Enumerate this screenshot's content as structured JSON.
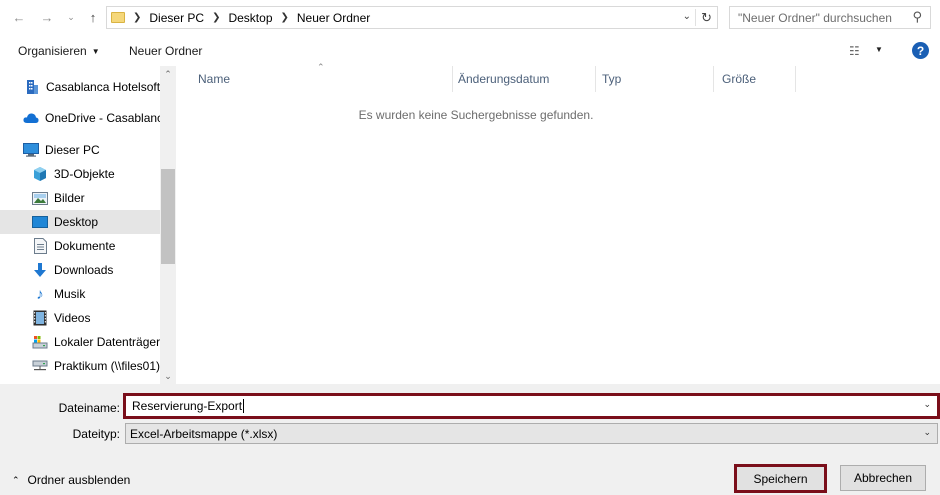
{
  "nav_buttons": {
    "back_icon": "arrow-left-icon",
    "forward_icon": "arrow-right-icon",
    "recent_icon": "chevron-down-icon",
    "up_icon": "arrow-up-icon"
  },
  "address": {
    "crumbs": [
      "Dieser PC",
      "Desktop",
      "Neuer Ordner"
    ]
  },
  "search": {
    "placeholder": "\"Neuer Ordner\" durchsuchen"
  },
  "toolbar": {
    "organize_label": "Organisieren",
    "new_folder_label": "Neuer Ordner"
  },
  "sidebar": {
    "items": [
      {
        "label": "Casablanca Hotelsoftware",
        "icon": "building-icon",
        "selected": false
      },
      {
        "label": "OneDrive - Casablanca",
        "icon": "cloud-icon",
        "selected": false
      },
      {
        "label": "Dieser PC",
        "icon": "computer-icon",
        "selected": false
      },
      {
        "label": "3D-Objekte",
        "icon": "cube-icon",
        "selected": false
      },
      {
        "label": "Bilder",
        "icon": "pictures-icon",
        "selected": false
      },
      {
        "label": "Desktop",
        "icon": "desktop-icon",
        "selected": true
      },
      {
        "label": "Dokumente",
        "icon": "document-icon",
        "selected": false
      },
      {
        "label": "Downloads",
        "icon": "download-icon",
        "selected": false
      },
      {
        "label": "Musik",
        "icon": "music-icon",
        "selected": false
      },
      {
        "label": "Videos",
        "icon": "video-icon",
        "selected": false
      },
      {
        "label": "Lokaler Datenträger",
        "icon": "drive-icon",
        "selected": false
      },
      {
        "label": "Praktikum (\\\\files01)",
        "icon": "network-drive-icon",
        "selected": false
      }
    ]
  },
  "columns": [
    "Name",
    "Änderungsdatum",
    "Typ",
    "Größe"
  ],
  "empty_message": "Es wurden keine Suchergebnisse gefunden.",
  "form": {
    "filename_label": "Dateiname:",
    "filename_value": "Reservierung-Export",
    "filetype_label": "Dateityp:",
    "filetype_value": "Excel-Arbeitsmappe (*.xlsx)"
  },
  "footer": {
    "hide_folders_label": "Ordner ausblenden",
    "save_label": "Speichern",
    "cancel_label": "Abbrechen"
  },
  "colors": {
    "highlight_border": "#7a0e1a",
    "selected_bg": "#e5e5e5",
    "header_text": "#4c607a"
  }
}
